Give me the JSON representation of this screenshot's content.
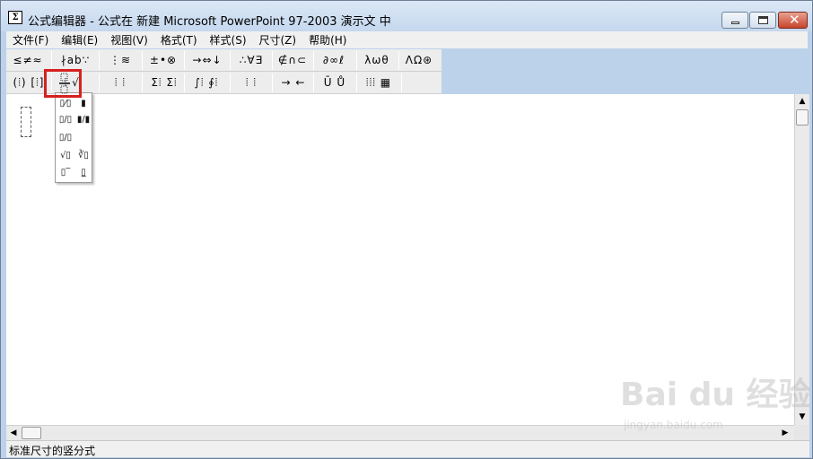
{
  "window": {
    "title": "公式编辑器 - 公式在 新建 Microsoft PowerPoint 97-2003 演示文 中",
    "app_icon_glyph": "Σ"
  },
  "menubar": {
    "items": [
      "文件(F)",
      "编辑(E)",
      "视图(V)",
      "格式(T)",
      "样式(S)",
      "尺寸(Z)",
      "帮助(H)"
    ]
  },
  "toolbar_row1": {
    "groups": [
      "≤≠≈",
      "∤ab∵",
      "⋮≋",
      "±•⊗",
      "→⇔↓",
      "∴∀∃",
      "∉∩⊂",
      "∂∞ℓ",
      "λωθ",
      "ΛΩ⊛"
    ]
  },
  "toolbar_row2": {
    "groups": [
      "(⦙) [⦙]",
      "⦙ √⦙",
      "⦙ ⦙",
      "Σ⦙ Σ⦙",
      "∫⦙ ∮⦙",
      "⦙ ⦙",
      "→ ←",
      "Ū Ů",
      "⦙⦙⦙ ▦"
    ]
  },
  "fraction_palette": {
    "cells": [
      "▯⁄▯",
      "▮",
      "▯∕▯",
      "▮∕▮",
      "▯/▯",
      "",
      "√▯",
      "∛▯",
      "▯‾",
      "▯̲"
    ]
  },
  "status": {
    "text": "标准尺寸的竖分式"
  },
  "watermark": {
    "logo": "Bai du 经验",
    "url": "jingyan.baidu.com"
  },
  "colors": {
    "highlight": "#d62020",
    "title_bg": "#c5d8ee"
  }
}
